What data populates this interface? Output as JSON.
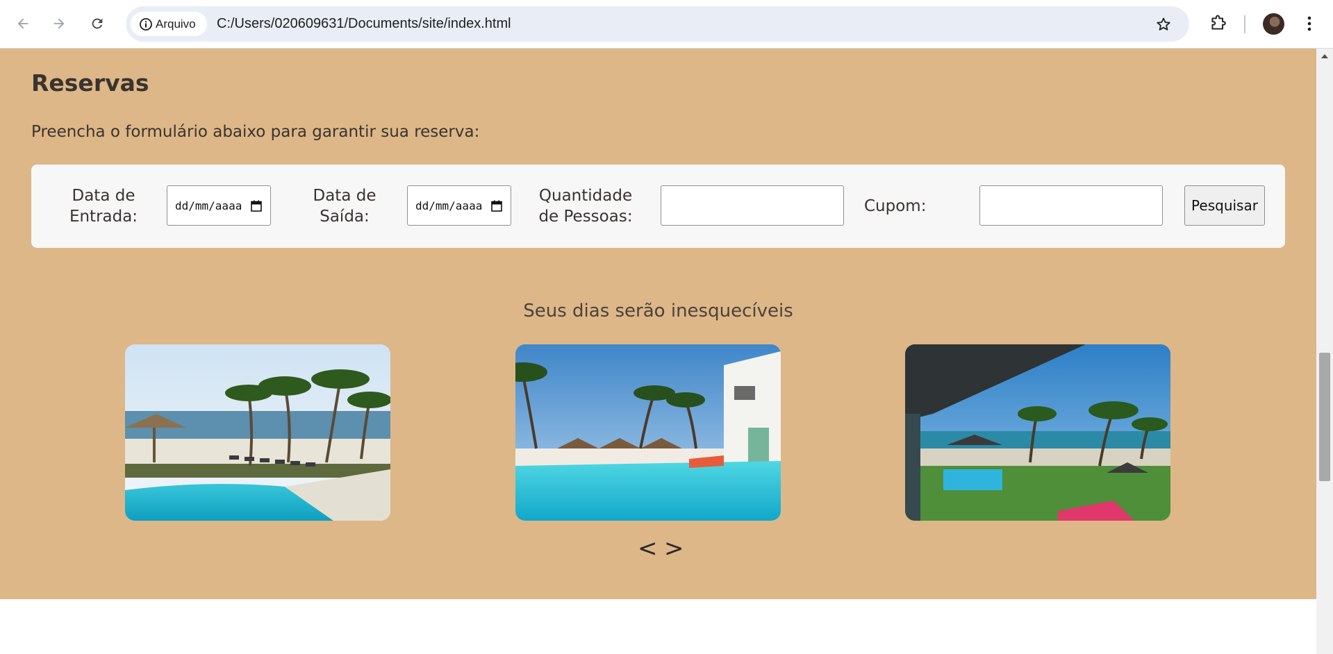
{
  "browser": {
    "site_chip_label": "Arquivo",
    "url": "C:/Users/020609631/Documents/site/index.html",
    "icons": {
      "back": "arrow-left-icon",
      "forward": "arrow-right-icon",
      "reload": "reload-icon",
      "site_info": "info-icon",
      "bookmark": "star-icon",
      "extensions": "puzzle-icon",
      "profile": "avatar",
      "menu": "kebab-menu-icon"
    }
  },
  "page": {
    "title": "Reservas",
    "subtitle": "Preencha o formulário abaixo para garantir sua reserva:",
    "background_color": "#ddb787",
    "form": {
      "checkin_label": "Data de Entrada:",
      "checkin_placeholder": "dd/mm/aaaa",
      "checkout_label": "Data de Saída:",
      "checkout_placeholder": "dd/mm/aaaa",
      "guests_label": "Quantidade de Pessoas:",
      "guests_value": "",
      "coupon_label": "Cupom:",
      "coupon_value": "",
      "search_button": "Pesquisar"
    },
    "gallery": {
      "heading": "Seus dias serão inesquecíveis",
      "prev_label": "<",
      "next_label": ">"
    }
  }
}
